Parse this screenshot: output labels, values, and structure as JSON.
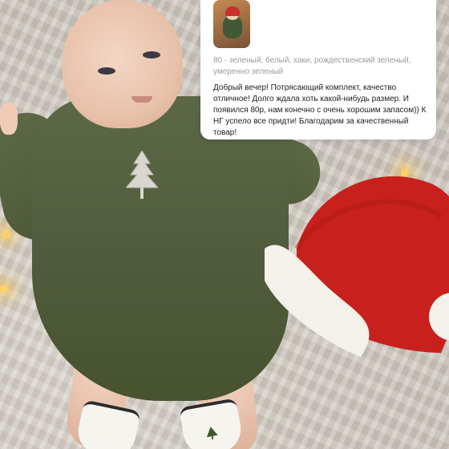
{
  "review": {
    "variant": "80 - зеленый, белый, хаки, рождественский зеленый, умеренно зеленый",
    "text": "Добрый вечер! Потрясающий комплект, качество отличное! Долго ждала хоть какой-нибудь размер. И появился 80р, нам конечно с очень хорошим запасом)) К НГ успело все придти! Благодарим за качественный товар!"
  },
  "colors": {
    "romper": "#4f5b3b",
    "hat_red": "#c8201c",
    "hat_trim": "#f3f1ea",
    "card_bg": "#ffffff",
    "variant_text": "#9a9aa0",
    "review_text": "#1d1d1f"
  },
  "icons": [
    "christmas-tree-icon"
  ]
}
